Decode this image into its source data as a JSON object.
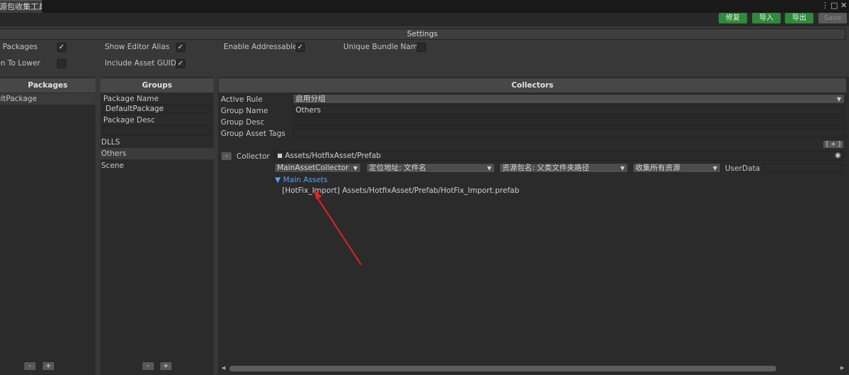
{
  "window": {
    "tab_title": "资源包收集工具",
    "menu_icon": "⋮",
    "maximize_icon": "□",
    "close_icon": "✕"
  },
  "toolbar": {
    "fix_label": "修复",
    "import_label": "导入",
    "export_label": "导出",
    "save_label": "Save"
  },
  "settings": {
    "header": "Settings",
    "options": {
      "show_packages": {
        "label": "Show Packages",
        "checked": true
      },
      "show_editor_alias": {
        "label": "Show Editor Alias",
        "checked": true
      },
      "enable_addressable": {
        "label": "Enable Addressable",
        "checked": true
      },
      "unique_bundle_name": {
        "label": "Unique Bundle Name",
        "checked": false
      },
      "location_to_lower": {
        "label": "Location To Lower",
        "checked": false
      },
      "include_asset_guid": {
        "label": "Include Asset GUID",
        "checked": true
      }
    },
    "check_mark": "✓"
  },
  "packages": {
    "header": "Packages",
    "items": [
      "DefaultPackage"
    ],
    "remove_label": "-",
    "add_label": "+"
  },
  "groups": {
    "header": "Groups",
    "package_name_label": "Package Name",
    "package_name_value": "DefaultPackage",
    "package_desc_label": "Package Desc",
    "package_desc_value": "",
    "items": [
      "DLLS",
      "Others",
      "Scene"
    ],
    "remove_label": "-",
    "add_label": "+"
  },
  "collectors": {
    "header": "Collectors",
    "active_rule_label": "Active Rule",
    "active_rule_value": "启用分组",
    "group_name_label": "Group Name",
    "group_name_value": "Others",
    "group_desc_label": "Group Desc",
    "group_desc_value": "",
    "group_tags_label": "Group Asset Tags",
    "group_tags_value": "",
    "add_collector_label": "[ + ]",
    "collector": {
      "remove_label": "-",
      "label": "Collector",
      "folder_icon": "■",
      "path": "Assets/HotfixAsset/Prefab",
      "target_icon": "◉",
      "collector_type": "MainAssetCollector",
      "address_rule": "定位地址: 文件名",
      "pack_rule": "资源包名: 父类文件夹路径",
      "filter_rule": "收集所有资源",
      "user_data_label": "UserData",
      "user_data_value": "",
      "main_assets_label": "▼ Main Assets",
      "main_assets": [
        "[HotFix_Import] Assets/HotfixAsset/Prefab/HotFix_Import.prefab"
      ]
    }
  },
  "scrollbar": {
    "left_arrow": "◀",
    "right_arrow": "▶"
  },
  "colors": {
    "accent_green": "#2f8a3b",
    "link_blue": "#5aa0ea",
    "annotation_red": "#e8231e"
  }
}
